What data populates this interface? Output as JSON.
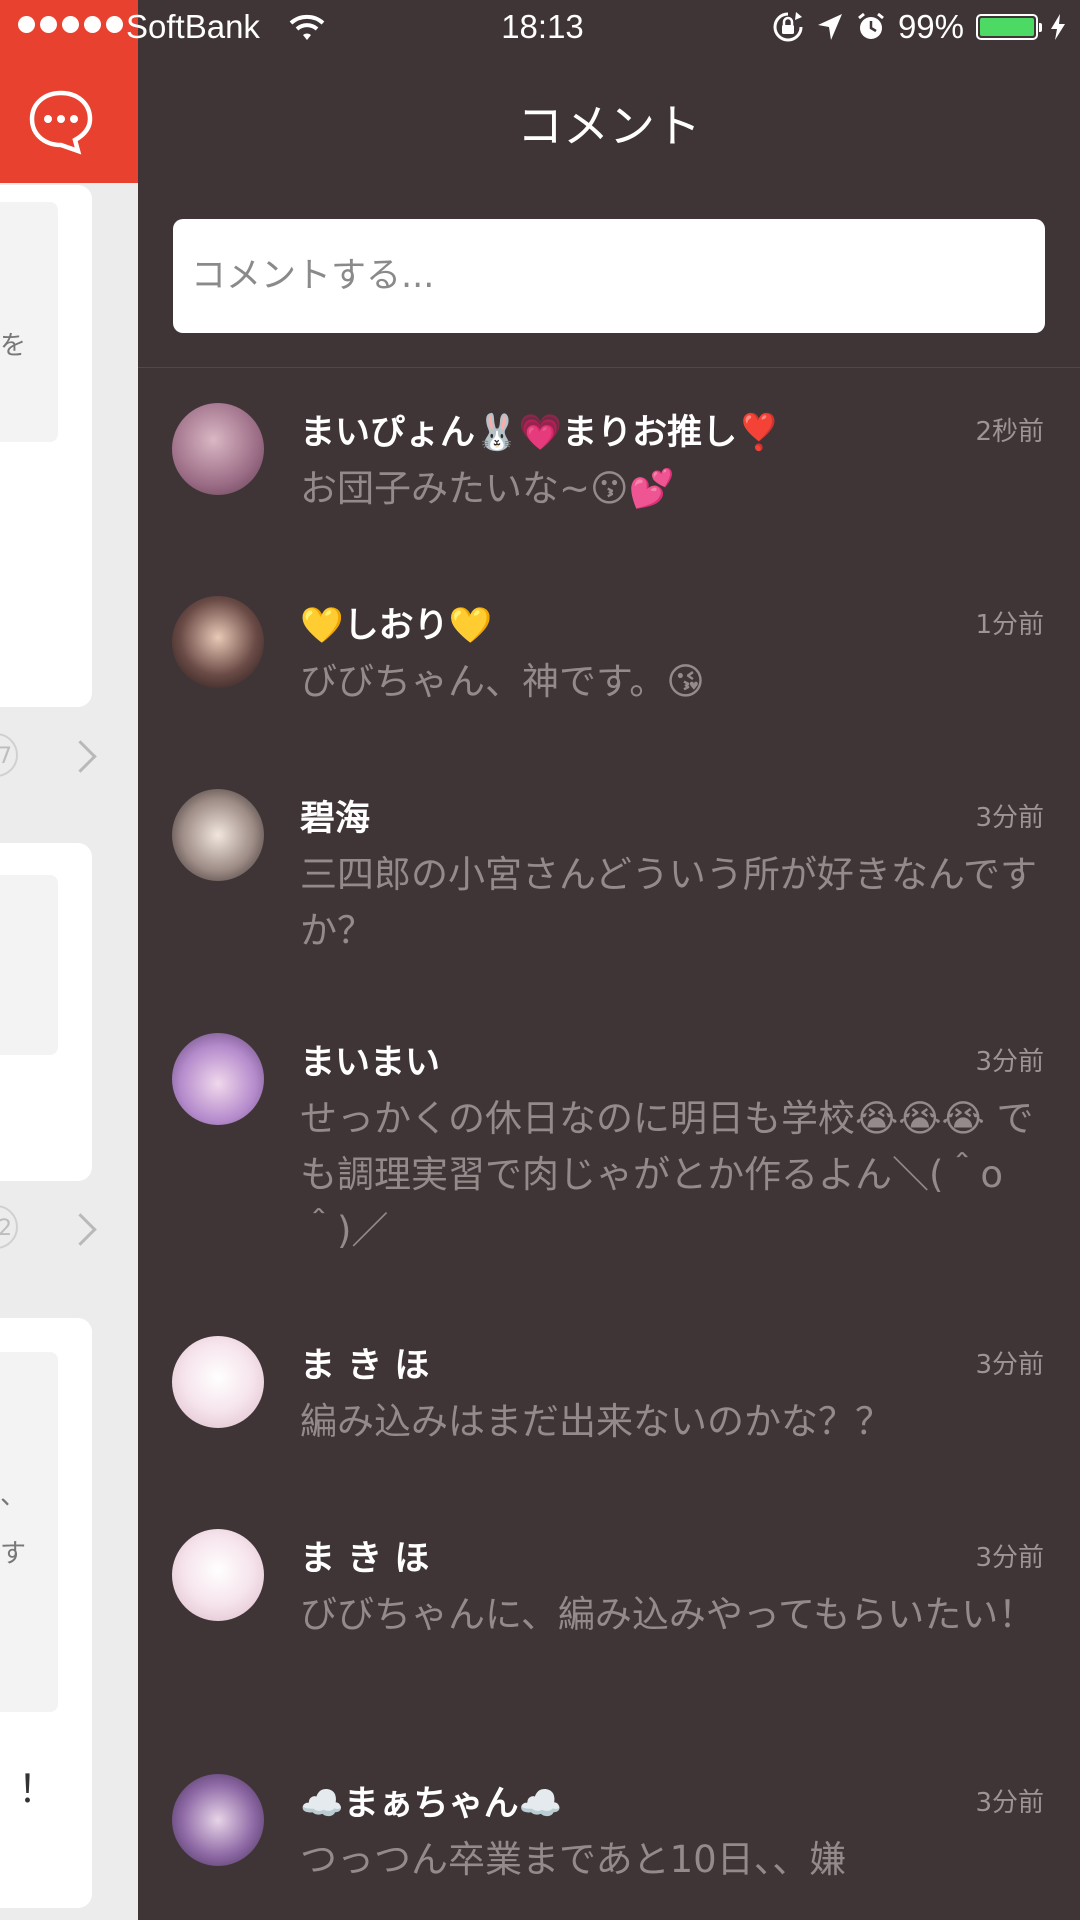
{
  "status_bar": {
    "carrier": "SoftBank",
    "time": "18:13",
    "battery": "99%"
  },
  "panel": {
    "title": "コメント",
    "input_placeholder": "コメントする..."
  },
  "comments": [
    {
      "user": "まいぴょん🐰💗まりお推し❣️",
      "time": "2秒前",
      "text": "お団子みたいな~😗💕"
    },
    {
      "user": "💛しおり💛",
      "time": "1分前",
      "text": "びびちゃん、神です。😘"
    },
    {
      "user": "碧海",
      "time": "3分前",
      "text": "三四郎の小宮さんどういう所が好きなんですか？"
    },
    {
      "user": "まいまい",
      "time": "3分前",
      "text": "せっかくの休日なのに明日も学校😭😭😭 でも調理実習で肉じゃがとか作るよん＼(＾o＾)／"
    },
    {
      "user": "ま き ほ",
      "time": "3分前",
      "text": "編み込みはまだ出来ないのかな？？"
    },
    {
      "user": "ま き ほ",
      "time": "3分前",
      "text": "びびちゃんに、編み込みやってもらいたい！"
    },
    {
      "user": "☁️まぁちゃん☁️",
      "time": "3分前",
      "text": "つっつん卒業まであと10日、、嫌"
    }
  ],
  "left_feed": {
    "badge_1": "7",
    "badge_2": "2",
    "fragment_1": "を",
    "fragment_2": "、",
    "fragment_3": "す",
    "fragment_4": "！"
  },
  "colors": {
    "accent_red": "#e8412f",
    "panel_bg": "#3f3536",
    "battery_green": "#4cd964"
  }
}
